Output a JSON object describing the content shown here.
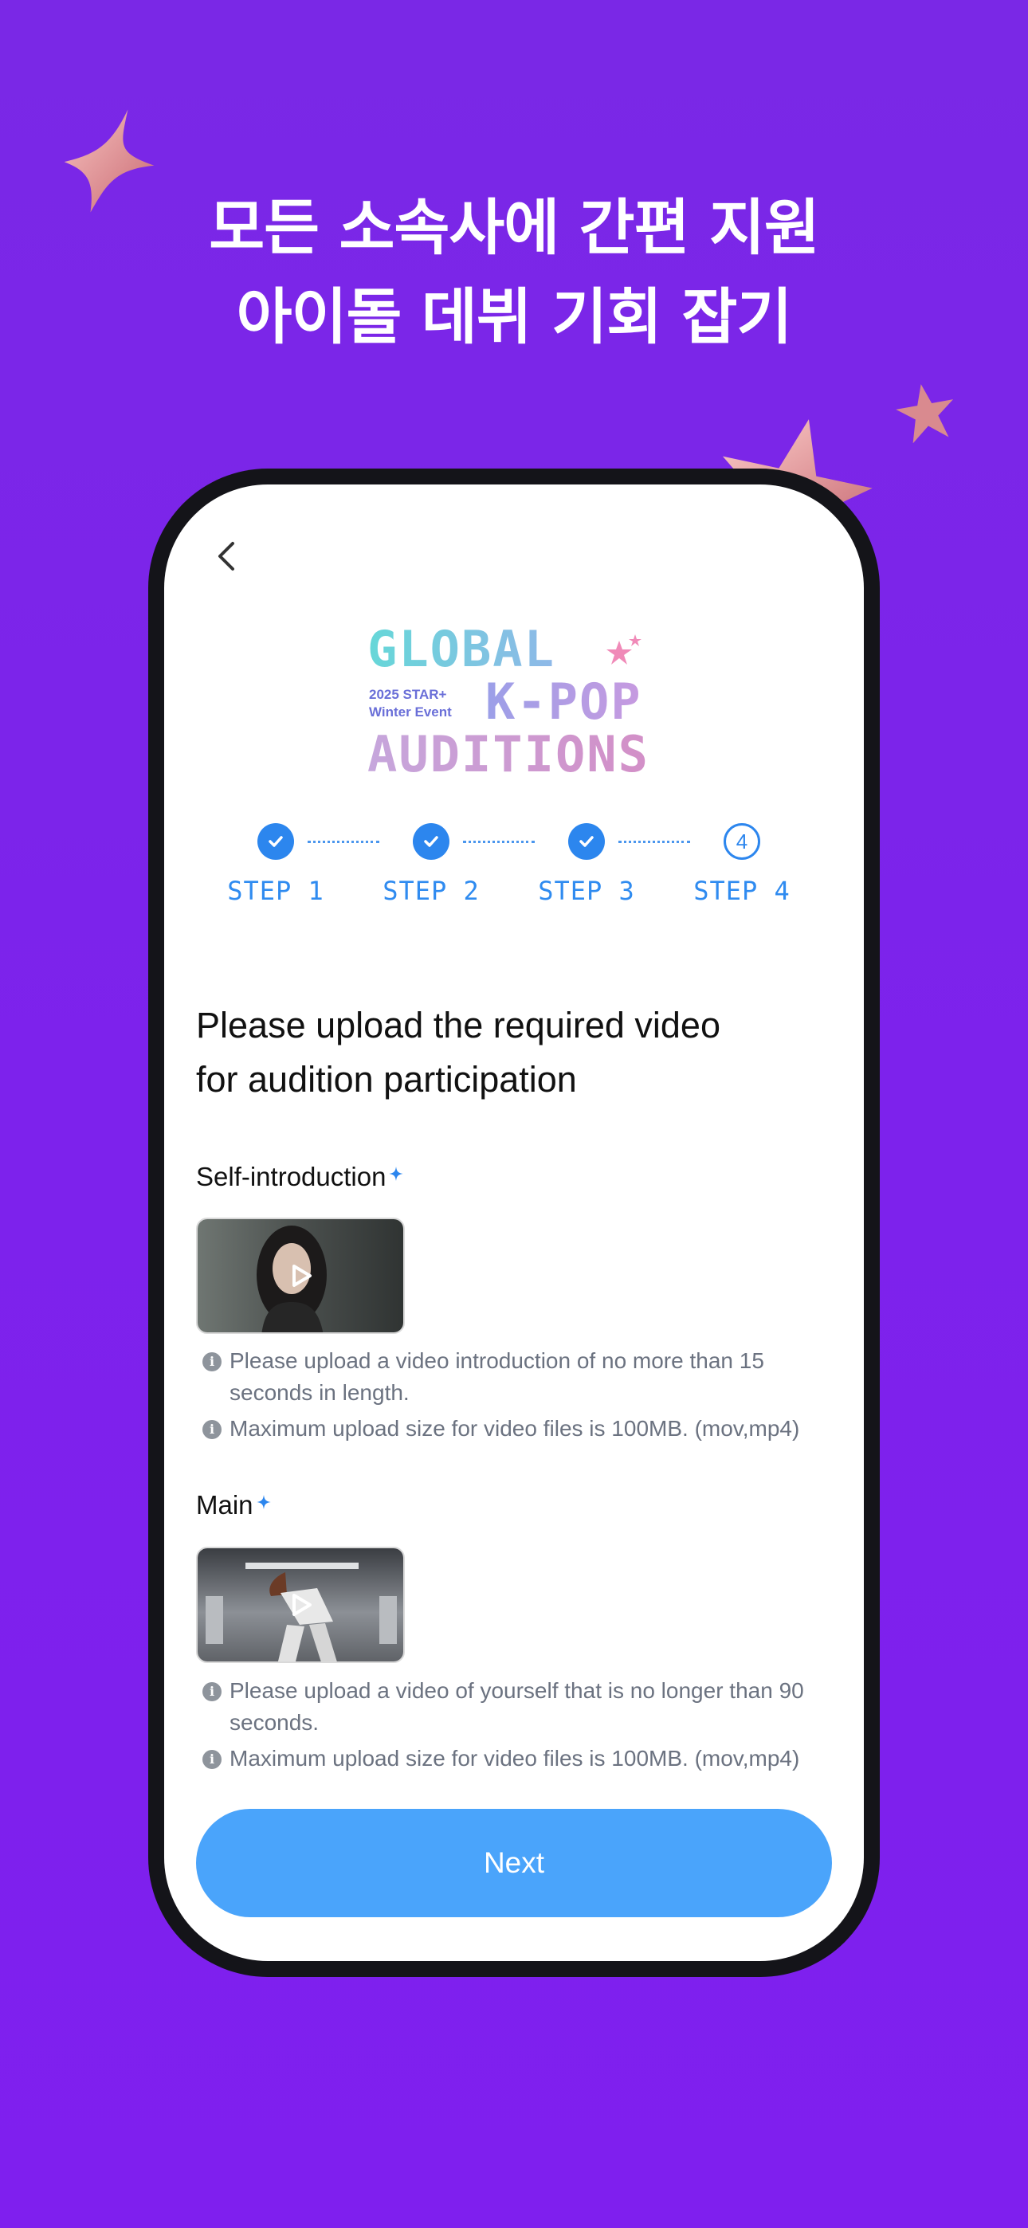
{
  "headline": {
    "line1": "모든 소속사에 간편 지원",
    "line2": "아이돌 데뷔 기회 잡기"
  },
  "logo": {
    "line1": "GLOBAL",
    "line2": "K-POP",
    "line3": "AUDITIONS",
    "event_line1": "2025 STAR+",
    "event_line2": "Winter Event"
  },
  "steps": [
    {
      "label": "STEP 1",
      "status": "done",
      "icon": "check-icon"
    },
    {
      "label": "STEP 2",
      "status": "done",
      "icon": "check-icon"
    },
    {
      "label": "STEP 3",
      "status": "done",
      "icon": "check-icon"
    },
    {
      "label": "STEP 4",
      "status": "current",
      "number": "4"
    }
  ],
  "main": {
    "title_line1": "Please upload the required video",
    "title_line2": "for audition participation",
    "sections": [
      {
        "label": "Self-introduction",
        "notes": [
          "Please upload a video introduction of no more than 15 seconds in length.",
          "Maximum upload size for video files is 100MB. (mov,mp4)"
        ]
      },
      {
        "label": "Main",
        "notes": [
          "Please upload a video of yourself that is no longer than 90 seconds.",
          "Maximum upload size for video files is 100MB. (mov,mp4)"
        ]
      }
    ],
    "next_label": "Next"
  },
  "colors": {
    "background": "#7d22ec",
    "accent": "#2c86ee",
    "button": "#4aa4fb"
  }
}
